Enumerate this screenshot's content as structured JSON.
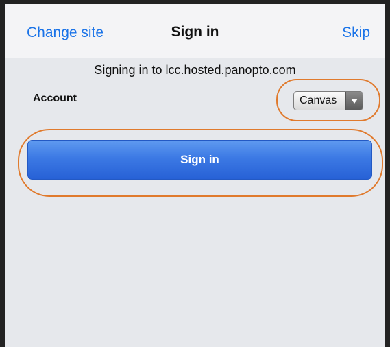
{
  "navbar": {
    "left_button": "Change site",
    "title": "Sign in",
    "right_button": "Skip"
  },
  "subtitle": "Signing in to lcc.hosted.panopto.com",
  "account": {
    "label": "Account",
    "selected": "Canvas"
  },
  "signin_button": "Sign in",
  "colors": {
    "accent": "#1a73e8",
    "highlight_ring": "#e07a2d",
    "button_blue": "#3c79e4",
    "background": "#e6e8ec"
  }
}
